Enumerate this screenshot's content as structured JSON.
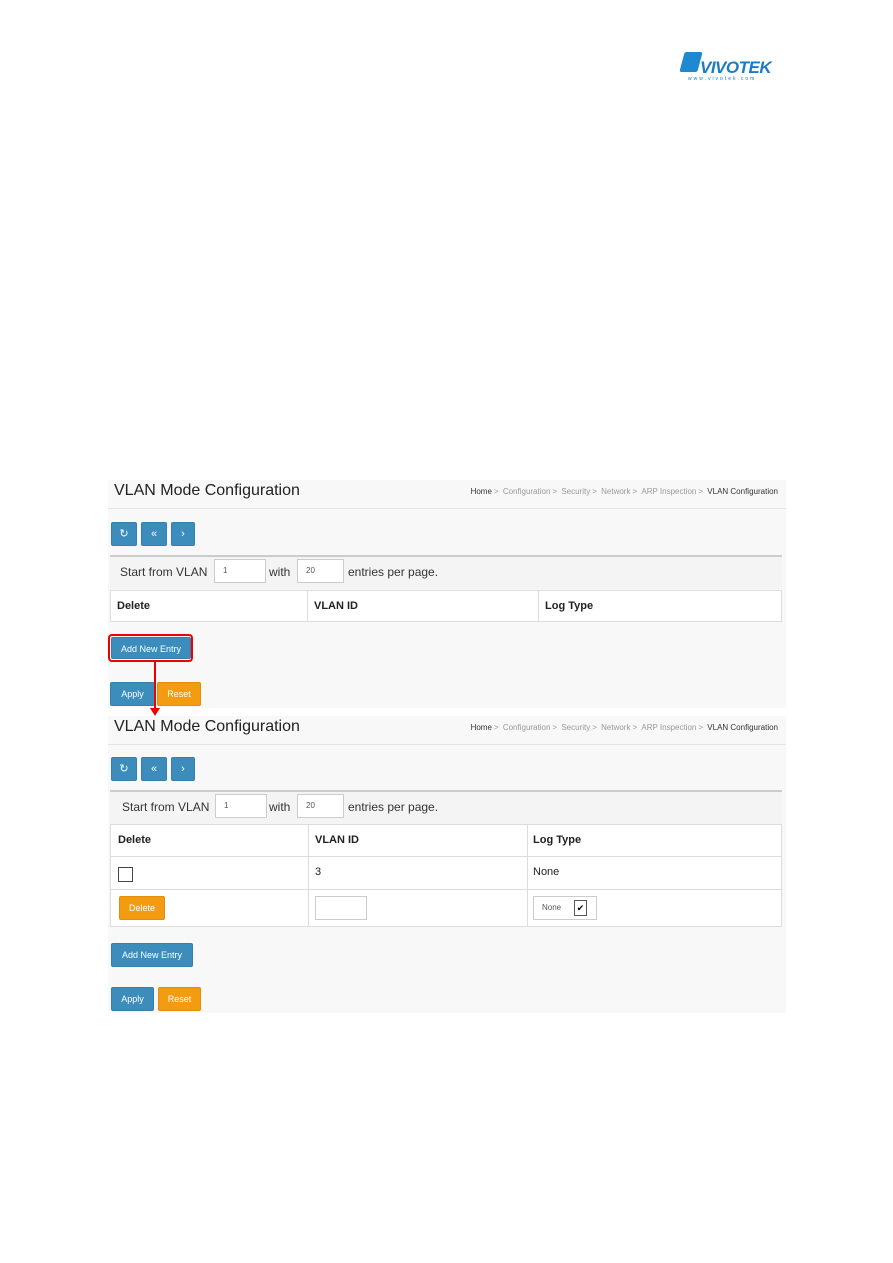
{
  "logo": {
    "text": "VIVOTEK",
    "sub": "www.vivotek.com"
  },
  "colors": {
    "primary": "#3c8dbc",
    "warning": "#f39c12",
    "highlight": "#e00000"
  },
  "before": {
    "title": "VLAN Mode Configuration",
    "breadcrumb": [
      "Home",
      "Configuration",
      "Security",
      "Network",
      "ARP Inspection",
      "VLAN Configuration"
    ],
    "toolbar": {
      "refresh_icon": "refresh-icon",
      "first_icon": "double-chevron-left-icon",
      "next_icon": "chevron-right-icon"
    },
    "start_label": "Start from VLAN",
    "start_value": "1",
    "with_label": "with",
    "per_page_value": "20",
    "per_page_label": "entries per page.",
    "columns": [
      "Delete",
      "VLAN ID",
      "Log Type"
    ],
    "add_label": "Add New Entry",
    "apply_label": "Apply",
    "reset_label": "Reset"
  },
  "after": {
    "title": "VLAN Mode Configuration",
    "breadcrumb": [
      "Home",
      "Configuration",
      "Security",
      "Network",
      "ARP Inspection",
      "VLAN Configuration"
    ],
    "start_label": "Start from VLAN",
    "start_value": "1",
    "with_label": "with",
    "per_page_value": "20",
    "per_page_label": "entries per page.",
    "columns": [
      "Delete",
      "VLAN ID",
      "Log Type"
    ],
    "rows": [
      {
        "delete_checked": false,
        "vlan_id": "3",
        "log_type": "None"
      }
    ],
    "new_row": {
      "delete_label": "Delete",
      "vlan_id": "",
      "log_type": "None"
    },
    "add_label": "Add New Entry",
    "apply_label": "Apply",
    "reset_label": "Reset"
  }
}
